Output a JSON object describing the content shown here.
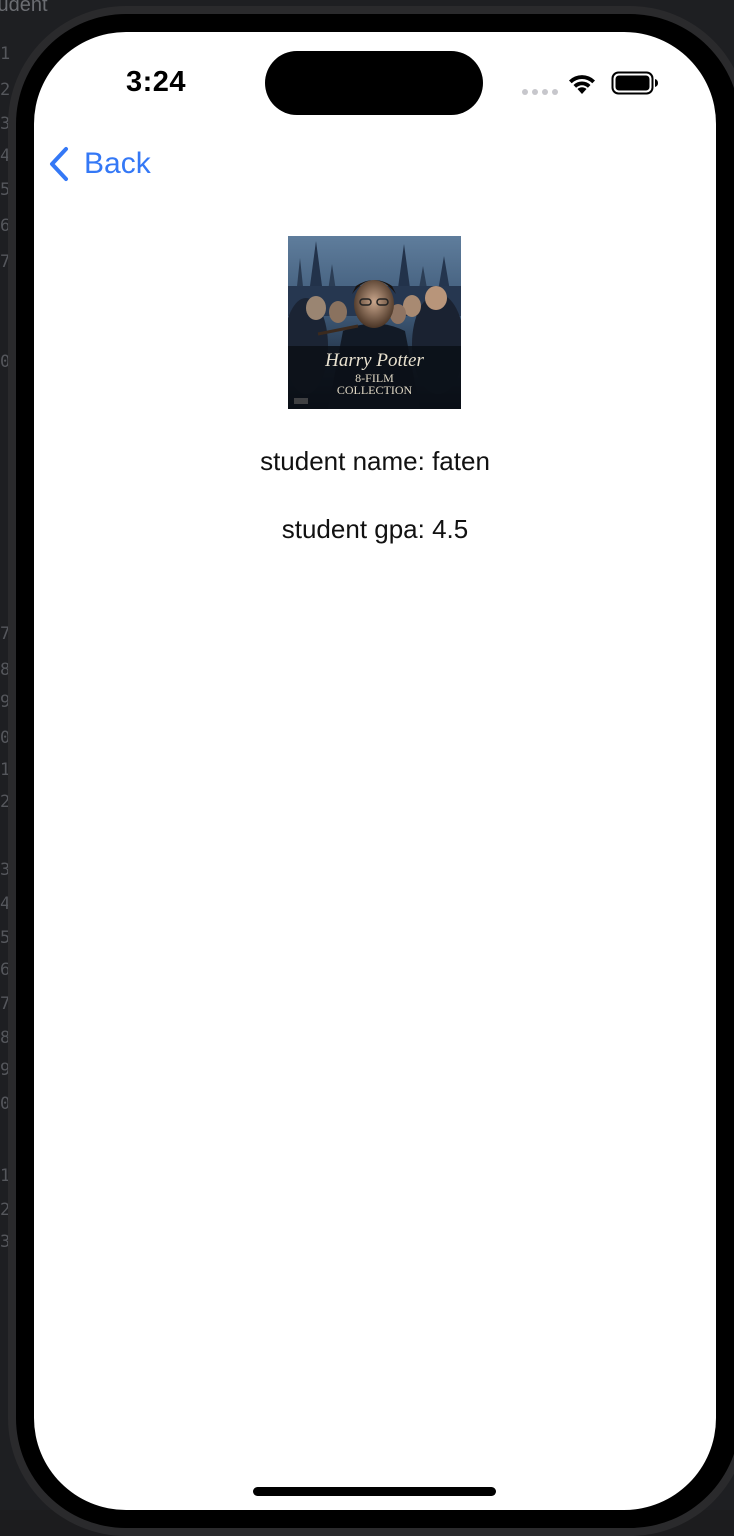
{
  "editor": {
    "tab_fragment": "tudent",
    "line_numbers": [
      "1",
      "2",
      "3",
      "4",
      "5",
      "6",
      "7",
      "0",
      "7",
      "8",
      "9",
      "0",
      "1",
      "2",
      "3",
      "4",
      "5",
      "6",
      "7",
      "8",
      "9",
      "0",
      "1",
      "2",
      "3"
    ]
  },
  "status_bar": {
    "time": "3:24",
    "wifi_icon": "wifi-icon",
    "battery_icon": "battery-icon"
  },
  "nav": {
    "back_label": "Back",
    "back_icon": "chevron-left-icon",
    "accent_color": "#3478f6"
  },
  "poster": {
    "title_line": "Harry Potter",
    "subtitle_line1": "8-FILM",
    "subtitle_line2": "COLLECTION"
  },
  "student": {
    "name_text": "student name: faten",
    "gpa_text": "student gpa: 4.5"
  }
}
